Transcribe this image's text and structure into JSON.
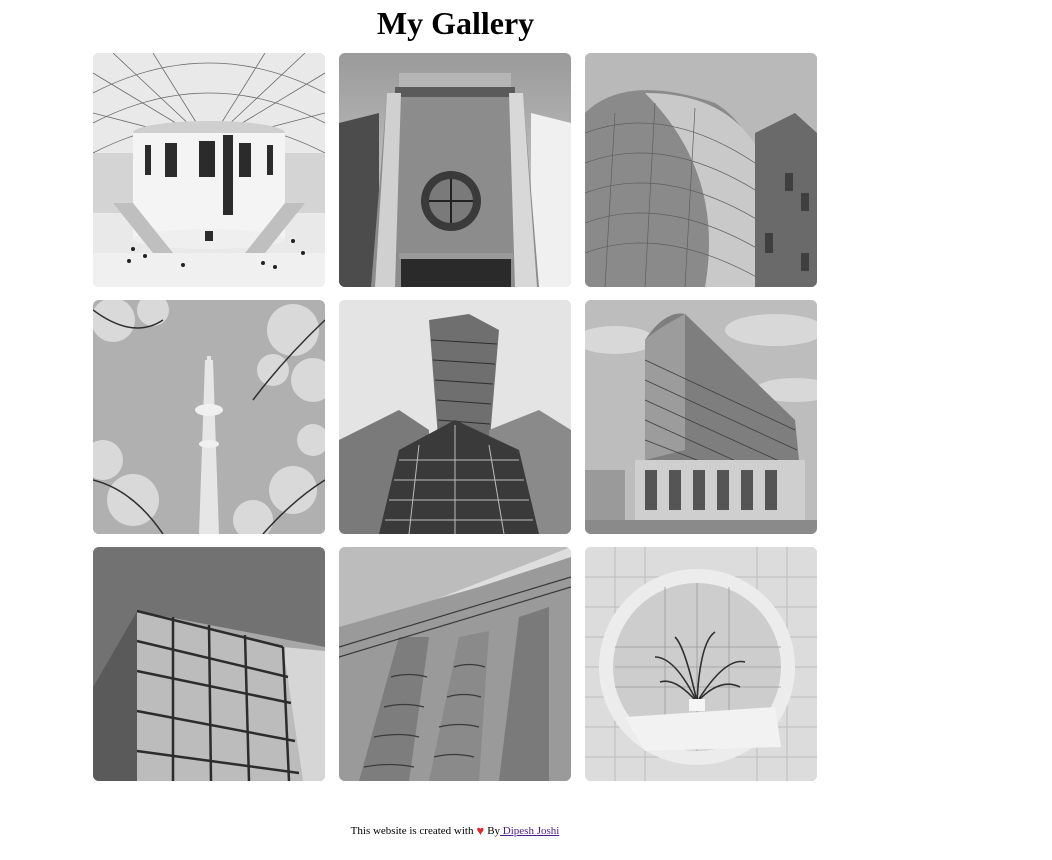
{
  "page": {
    "title": "My Gallery"
  },
  "gallery": {
    "images": [
      {
        "subject": "museum-dome-interior"
      },
      {
        "subject": "building-round-window"
      },
      {
        "subject": "curved-facade"
      },
      {
        "subject": "tv-tower-blossoms"
      },
      {
        "subject": "glass-skyscraper"
      },
      {
        "subject": "curved-office-building"
      },
      {
        "subject": "glass-box-building"
      },
      {
        "subject": "ornate-columns"
      },
      {
        "subject": "round-window-plant"
      }
    ]
  },
  "footer": {
    "text_before": "This website is created with",
    "heart_icon": "heart-icon",
    "heart_glyph": "♥",
    "by_text": "By",
    "author_link": " Dipesh Joshi",
    "heart_color": "#e0282e",
    "link_color": "#4b1b8c"
  }
}
